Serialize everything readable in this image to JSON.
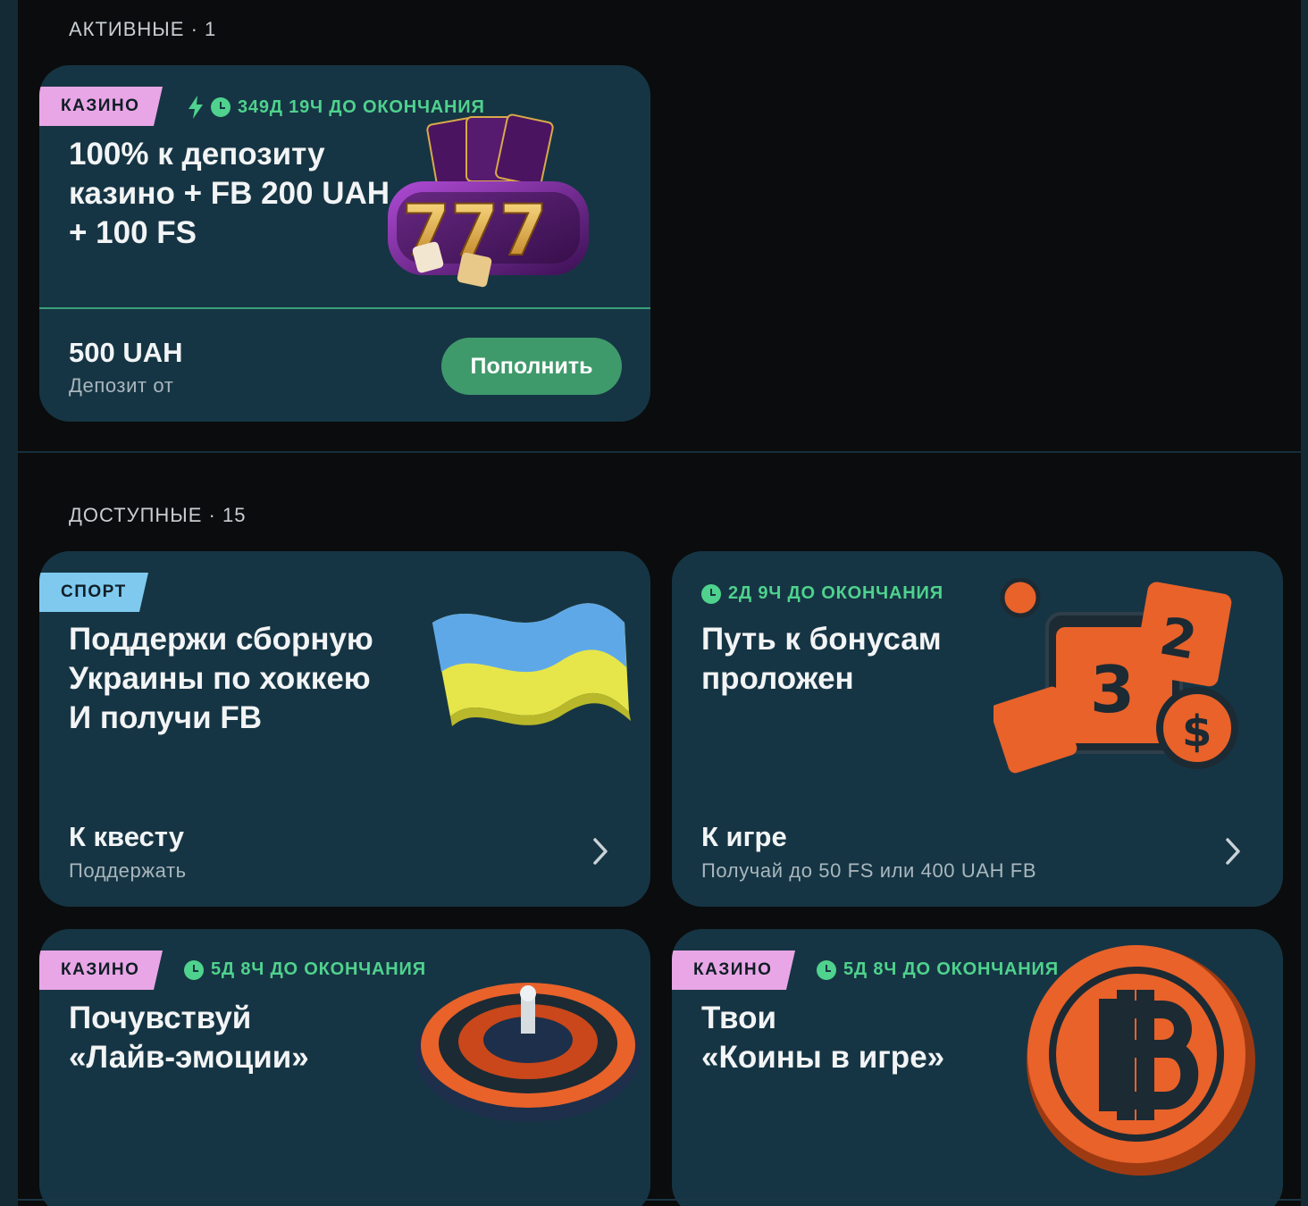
{
  "sections": {
    "active": {
      "title": "АКТИВНЫЕ · 1"
    },
    "available": {
      "title": "ДОСТУПНЫЕ · 15"
    }
  },
  "active_card": {
    "badge": "КАЗИНО",
    "timer": "349Д 19Ч ДО ОКОНЧАНИЯ",
    "title": "100% к депозиту\nказино + FB 200 UAH\n+ 100 FS",
    "amount": "500 UAH",
    "amount_label": "Депозит от",
    "button": "Пополнить",
    "art": "slot-machine-777-icon"
  },
  "cards": [
    {
      "badge": "СПОРТ",
      "title": "Поддержи сборную\nУкраины по хоккею\nИ получи FB",
      "foot_title": "К квесту",
      "foot_sub": "Поддержать",
      "art": "ukraine-flag-icon"
    },
    {
      "timer": "2Д 9Ч ДО ОКОНЧАНИЯ",
      "title": "Путь к бонусам\nпроложен",
      "foot_title": "К игре",
      "foot_sub": "Получай до 50 FS или 400 UAH FB",
      "art": "calendar-coins-icon"
    },
    {
      "badge": "КАЗИНО",
      "timer": "5Д 8Ч ДО ОКОНЧАНИЯ",
      "title": "Почувствуй\n«Лайв-эмоции»",
      "art": "roulette-wheel-icon"
    },
    {
      "badge": "КАЗИНО",
      "timer": "5Д 8Ч ДО ОКОНЧАНИЯ",
      "title": "Твои\n«Коины в игре»",
      "art": "bitcoin-coin-icon"
    }
  ],
  "colors": {
    "background": "#0b0c0d",
    "card": "#163544",
    "accent_green": "#4fd28d",
    "button_green": "#3f9a6b",
    "badge_casino": "#e9a6e6",
    "badge_sport": "#7fc9ef"
  }
}
